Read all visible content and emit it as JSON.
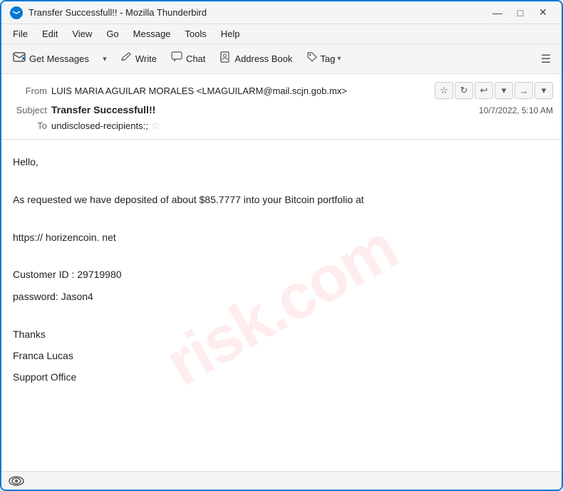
{
  "window": {
    "title": "Transfer Successfull!! - Mozilla Thunderbird",
    "controls": {
      "minimize": "—",
      "maximize": "□",
      "close": "✕"
    }
  },
  "menubar": {
    "items": [
      "File",
      "Edit",
      "View",
      "Go",
      "Message",
      "Tools",
      "Help"
    ]
  },
  "toolbar": {
    "get_messages_label": "Get Messages",
    "write_label": "Write",
    "chat_label": "Chat",
    "address_book_label": "Address Book",
    "tag_label": "Tag",
    "hamburger_label": "☰"
  },
  "email": {
    "from_label": "From",
    "from_value": "LUIS MARIA AGUILAR MORALES <LMAGUILARM@mail.scjn.gob.mx>",
    "subject_label": "Subject",
    "subject_value": "Transfer Successfull!!",
    "date_value": "10/7/2022, 5:10 AM",
    "to_label": "To",
    "to_value": "undisclosed-recipients:;"
  },
  "body": {
    "line1": "Hello,",
    "line2": "As requested we have deposited of about $85.7777 into your Bitcoin portfolio at",
    "line3": "https:// horizencoin. net",
    "line4": "Customer ID : 29719980",
    "line5": "password:    Jason4",
    "line6": "Thanks",
    "line7": "Franca Lucas",
    "line8": "Support Office"
  },
  "statusbar": {
    "signal_icon": "((·))"
  },
  "watermark": {
    "text": "risk.com"
  }
}
